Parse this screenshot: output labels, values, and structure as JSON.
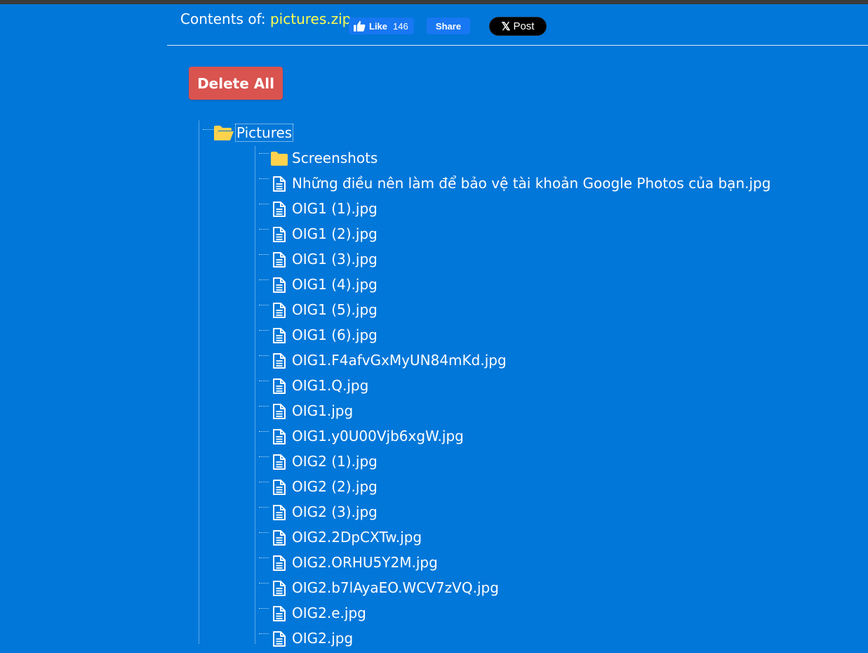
{
  "header": {
    "contents_prefix": "Contents of: ",
    "archive_name": "pictures.zip",
    "archive_color": "#ffff4d"
  },
  "social": {
    "fb_like_label": "Like",
    "fb_like_count": "146",
    "fb_share_label": "Share",
    "x_logo": "𝕏",
    "x_post_label": "Post"
  },
  "actions": {
    "delete_all_label": "Delete All",
    "delete_color": "#d9534f"
  },
  "colors": {
    "background": "#0077d9",
    "folder": "#ffd24d",
    "fb_blue": "#1877f2"
  },
  "tree": {
    "root": {
      "name": "Pictures",
      "icon": "folder-open-icon"
    },
    "children": [
      {
        "name": "Screenshots",
        "type": "folder",
        "icon": "folder-icon"
      },
      {
        "name": "Những điều nên làm để bảo vệ tài khoản Google Photos của bạn.jpg",
        "type": "file",
        "icon": "file-icon"
      },
      {
        "name": "OIG1 (1).jpg",
        "type": "file",
        "icon": "file-icon"
      },
      {
        "name": "OIG1 (2).jpg",
        "type": "file",
        "icon": "file-icon"
      },
      {
        "name": "OIG1 (3).jpg",
        "type": "file",
        "icon": "file-icon"
      },
      {
        "name": "OIG1 (4).jpg",
        "type": "file",
        "icon": "file-icon"
      },
      {
        "name": "OIG1 (5).jpg",
        "type": "file",
        "icon": "file-icon"
      },
      {
        "name": "OIG1 (6).jpg",
        "type": "file",
        "icon": "file-icon"
      },
      {
        "name": "OIG1.F4afvGxMyUN84mKd.jpg",
        "type": "file",
        "icon": "file-icon"
      },
      {
        "name": "OIG1.Q.jpg",
        "type": "file",
        "icon": "file-icon"
      },
      {
        "name": "OIG1.jpg",
        "type": "file",
        "icon": "file-icon"
      },
      {
        "name": "OIG1.y0U00Vjb6xgW.jpg",
        "type": "file",
        "icon": "file-icon"
      },
      {
        "name": "OIG2 (1).jpg",
        "type": "file",
        "icon": "file-icon"
      },
      {
        "name": "OIG2 (2).jpg",
        "type": "file",
        "icon": "file-icon"
      },
      {
        "name": "OIG2 (3).jpg",
        "type": "file",
        "icon": "file-icon"
      },
      {
        "name": "OIG2.2DpCXTw.jpg",
        "type": "file",
        "icon": "file-icon"
      },
      {
        "name": "OIG2.ORHU5Y2M.jpg",
        "type": "file",
        "icon": "file-icon"
      },
      {
        "name": "OIG2.b7lAyaEO.WCV7zVQ.jpg",
        "type": "file",
        "icon": "file-icon"
      },
      {
        "name": "OIG2.e.jpg",
        "type": "file",
        "icon": "file-icon"
      },
      {
        "name": "OIG2.jpg",
        "type": "file",
        "icon": "file-icon"
      }
    ]
  }
}
